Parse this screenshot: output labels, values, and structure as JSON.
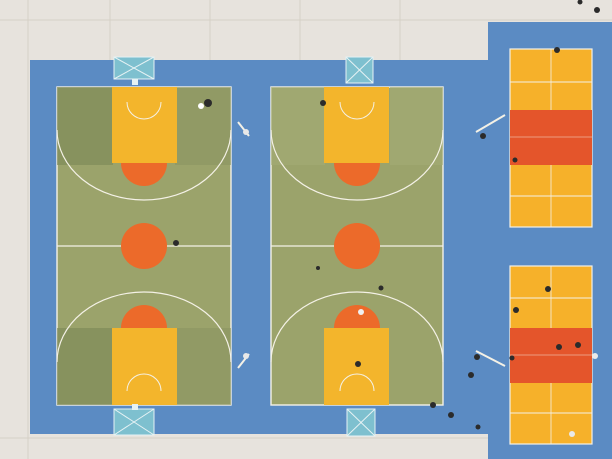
{
  "scene": {
    "description_label": "",
    "colors": {
      "pavement": "#e7e3dd",
      "pavement_tile": "#d9d4cc",
      "blue_surface": "#5d8cc2",
      "blue_surface_dark": "#4f7fb8",
      "court_green": "#9aa46c",
      "court_green_dark": "#7f8a58",
      "key_yellow": "#f3b52c",
      "circle_orange": "#ec6a2a",
      "volley_yellow": "#f6b12a",
      "volley_red": "#e4552b",
      "line_white": "#f4f1e6",
      "hoop_blue": "#7ec0cf"
    },
    "objects": [
      {
        "name": "basketball-court-left"
      },
      {
        "name": "basketball-court-center"
      },
      {
        "name": "volleyball-court-top-right"
      },
      {
        "name": "volleyball-court-bottom-right"
      },
      {
        "name": "basketball-hoops",
        "count": 4
      },
      {
        "name": "people",
        "approximate_count": 24
      }
    ]
  }
}
